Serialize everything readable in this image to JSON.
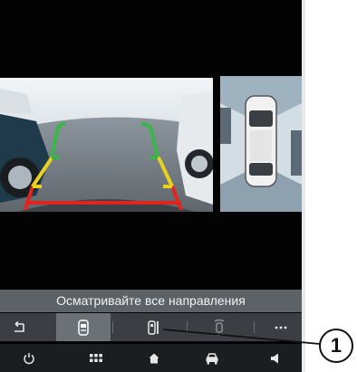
{
  "message": "Осматривайте все направления",
  "toolbar": {
    "buttons": [
      {
        "icon": "back-icon"
      },
      {
        "icon": "rear-camera-view-icon",
        "selected": true
      },
      {
        "icon": "side-camera-view-icon"
      },
      {
        "icon": "sensor-view-icon"
      },
      {
        "icon": "more-icon"
      }
    ]
  },
  "nav": {
    "buttons": [
      {
        "icon": "power-icon"
      },
      {
        "icon": "apps-grid-icon"
      },
      {
        "icon": "home-icon"
      },
      {
        "icon": "car-icon"
      },
      {
        "icon": "volume-icon"
      }
    ]
  },
  "callout": {
    "label": "1"
  },
  "colors": {
    "guide_near": "#e2241f",
    "guide_mid": "#e8d21c",
    "guide_far": "#39b54a"
  }
}
